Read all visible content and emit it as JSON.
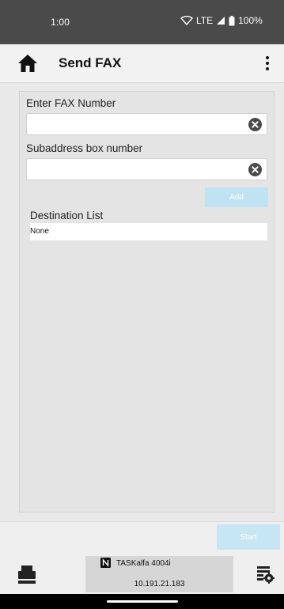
{
  "status_bar": {
    "time": "1:00",
    "network": "LTE",
    "battery": "100%"
  },
  "app_bar": {
    "title": "Send FAX",
    "icons": {
      "home": "home-icon",
      "menu": "more-vert-icon"
    }
  },
  "form": {
    "fax_number": {
      "label": "Enter FAX Number",
      "value": "",
      "placeholder": ""
    },
    "subaddress": {
      "label": "Subaddress box number",
      "value": "",
      "placeholder": ""
    },
    "add_label": "Add"
  },
  "destinations": {
    "label": "Destination List",
    "items": [
      "None"
    ]
  },
  "actions": {
    "start_label": "Start"
  },
  "device": {
    "name": "TASKalfa 4004i",
    "ip": "10.191.21.183"
  },
  "colors": {
    "status_bar": "#4a4a4a",
    "disabled_button": "#bfe3f3",
    "background": "#e9e9e9"
  }
}
